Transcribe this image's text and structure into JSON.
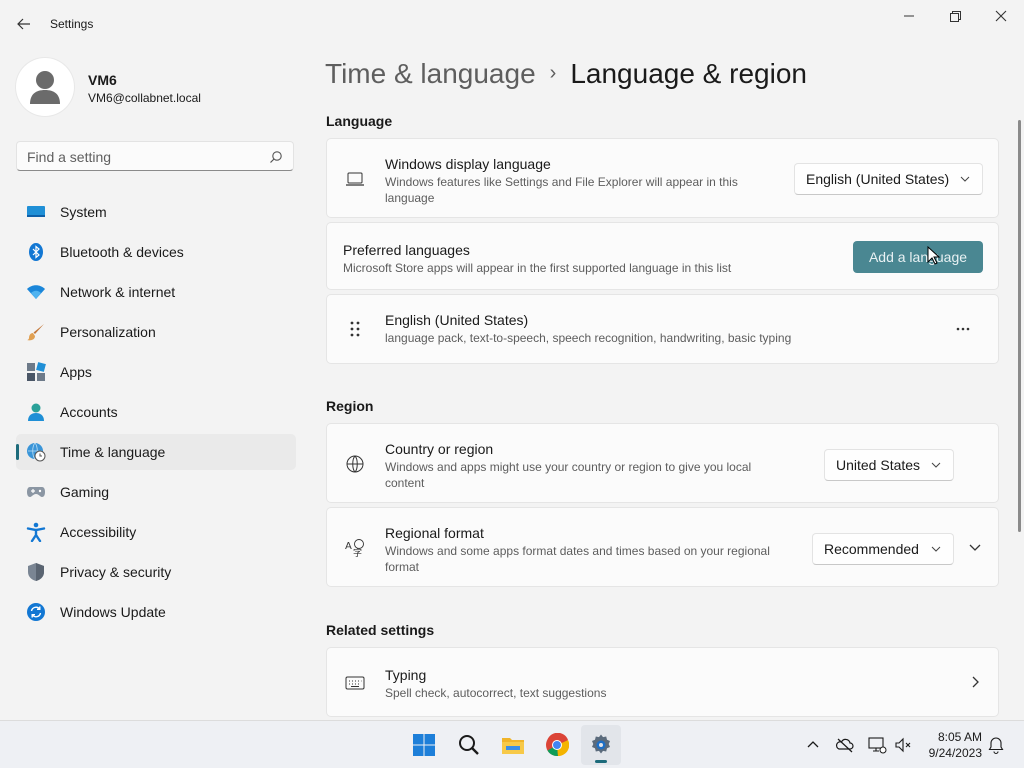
{
  "window": {
    "app_title": "Settings",
    "controls": [
      "minimize-icon",
      "maximize-icon",
      "close-icon"
    ]
  },
  "profile": {
    "name": "VM6",
    "email": "VM6@collabnet.local"
  },
  "search": {
    "placeholder": "Find a setting"
  },
  "sidebar": {
    "items": [
      {
        "label": "System",
        "icon": "system-icon",
        "active": false
      },
      {
        "label": "Bluetooth & devices",
        "icon": "bluetooth-icon",
        "active": false
      },
      {
        "label": "Network & internet",
        "icon": "wifi-icon",
        "active": false
      },
      {
        "label": "Personalization",
        "icon": "brush-icon",
        "active": false
      },
      {
        "label": "Apps",
        "icon": "apps-icon",
        "active": false
      },
      {
        "label": "Accounts",
        "icon": "accounts-icon",
        "active": false
      },
      {
        "label": "Time & language",
        "icon": "time-language-icon",
        "active": true
      },
      {
        "label": "Gaming",
        "icon": "gamepad-icon",
        "active": false
      },
      {
        "label": "Accessibility",
        "icon": "accessibility-icon",
        "active": false
      },
      {
        "label": "Privacy & security",
        "icon": "shield-icon",
        "active": false
      },
      {
        "label": "Windows Update",
        "icon": "update-icon",
        "active": false
      }
    ]
  },
  "breadcrumb": {
    "parent": "Time & language",
    "separator": "›",
    "current": "Language & region"
  },
  "language_section": {
    "title": "Language",
    "display_language": {
      "title": "Windows display language",
      "description": "Windows features like Settings and File Explorer will appear in this language",
      "value": "English (United States)"
    },
    "preferred": {
      "title": "Preferred languages",
      "description": "Microsoft Store apps will appear in the first supported language in this list",
      "button_label": "Add a language"
    },
    "installed": {
      "title": "English (United States)",
      "description": "language pack, text-to-speech, speech recognition, handwriting, basic typing",
      "more_label": "···"
    }
  },
  "region_section": {
    "title": "Region",
    "country": {
      "title": "Country or region",
      "description": "Windows and apps might use your country or region to give you local content",
      "value": "United States"
    },
    "format": {
      "title": "Regional format",
      "description": "Windows and some apps format dates and times based on your regional format",
      "value": "Recommended"
    }
  },
  "related_section": {
    "title": "Related settings",
    "typing": {
      "title": "Typing",
      "description": "Spell check, autocorrect, text suggestions"
    }
  },
  "taskbar": {
    "apps": [
      "windows-start-icon",
      "search-icon",
      "file-explorer-icon",
      "chrome-icon",
      "settings-icon"
    ],
    "active_app": "settings-icon",
    "tray": [
      "chevron-up-icon",
      "onedrive-icon",
      "network-icon",
      "volume-icon",
      "notification-icon"
    ],
    "time": "8:05 AM",
    "date": "9/24/2023"
  },
  "colors": {
    "accent": "#4a8792",
    "accent_indicator": "#1d6b7b",
    "background": "#f3f3f3",
    "card": "#fbfbfb"
  }
}
